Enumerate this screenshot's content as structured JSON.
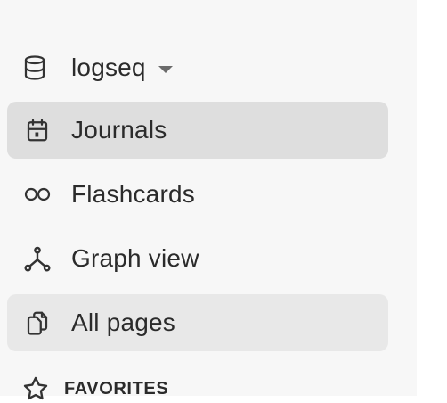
{
  "sidebar": {
    "repo": {
      "name": "logseq"
    },
    "items": [
      {
        "label": "Journals",
        "icon": "calendar-icon",
        "state": "active"
      },
      {
        "label": "Flashcards",
        "icon": "infinity-icon",
        "state": "normal"
      },
      {
        "label": "Graph view",
        "icon": "graph-icon",
        "state": "normal"
      },
      {
        "label": "All pages",
        "icon": "pages-icon",
        "state": "hovered"
      }
    ],
    "favorites": {
      "label": "FAVORITES",
      "icon": "star-icon"
    }
  },
  "colors": {
    "sidebar_bg": "#f7f7f7",
    "active_bg": "#dedede",
    "hover_bg": "#e8e8e8",
    "text": "#2b2b2b"
  }
}
